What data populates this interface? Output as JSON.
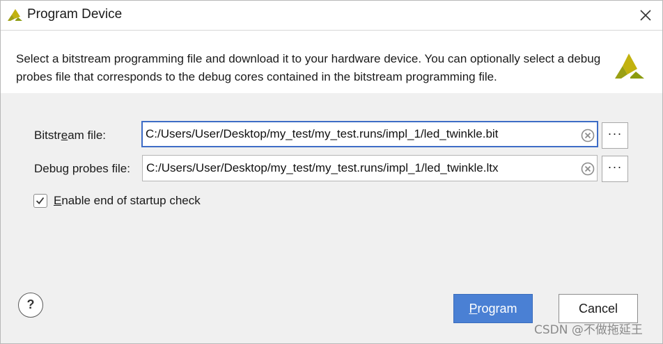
{
  "window": {
    "title": "Program Device",
    "logo_icon": "xilinx-logo-icon",
    "close_icon": "close-icon"
  },
  "description": {
    "text": "Select a bitstream programming file and download it to your hardware device. You can optionally select a debug probes file that corresponds to the debug cores contained in the bitstream programming file."
  },
  "fields": {
    "bitstream": {
      "label_pre": "Bitstr",
      "label_mnemonic": "e",
      "label_post": "am file:",
      "value": "C:/Users/User/Desktop/my_test/my_test.runs/impl_1/led_twinkle.bit",
      "browse_label": "···"
    },
    "debug_probes": {
      "label": "Debug probes file:",
      "value": "C:/Users/User/Desktop/my_test/my_test.runs/impl_1/led_twinkle.ltx",
      "browse_label": "···"
    }
  },
  "startup_check": {
    "checked": true,
    "label_mnemonic": "E",
    "label_rest": "nable end of startup check"
  },
  "buttons": {
    "help": "?",
    "program_mnemonic": "P",
    "program_rest": "rogram",
    "cancel": "Cancel"
  },
  "watermark": "CSDN @不做拖延王",
  "colors": {
    "accent": "#4a80d4",
    "focus_border": "#3d6cc6",
    "logo_yellow": "#c2b20e",
    "logo_green": "#8b9b0e"
  }
}
